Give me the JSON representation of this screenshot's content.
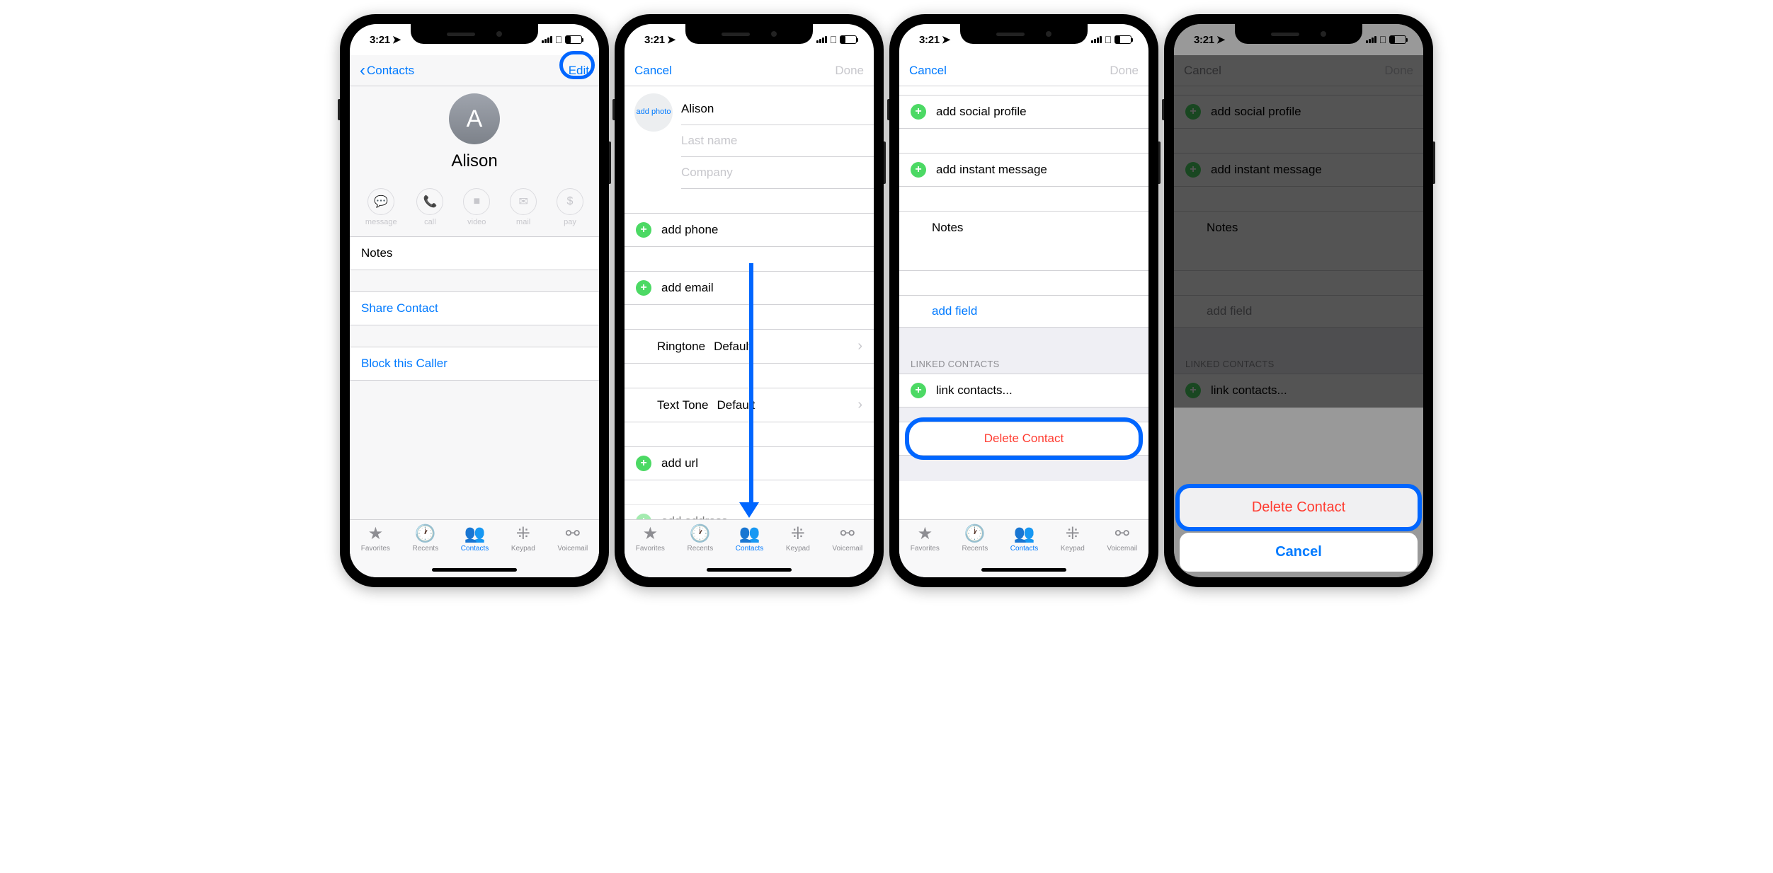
{
  "status": {
    "time": "3:21",
    "location_arrow": "↗"
  },
  "tabs": {
    "favorites": "Favorites",
    "recents": "Recents",
    "contacts": "Contacts",
    "keypad": "Keypad",
    "voicemail": "Voicemail"
  },
  "screen1": {
    "back": "Contacts",
    "edit": "Edit",
    "avatar_initial": "A",
    "name": "Alison",
    "actions": {
      "message": "message",
      "call": "call",
      "video": "video",
      "mail": "mail",
      "pay": "pay"
    },
    "notes": "Notes",
    "share": "Share Contact",
    "block": "Block this Caller"
  },
  "screen2": {
    "cancel": "Cancel",
    "done": "Done",
    "add_photo": "add photo",
    "first_name": "Alison",
    "last_name_ph": "Last name",
    "company_ph": "Company",
    "add_phone": "add phone",
    "add_email": "add email",
    "ringtone_label": "Ringtone",
    "ringtone_value": "Default",
    "texttone_label": "Text Tone",
    "texttone_value": "Default",
    "add_url": "add url",
    "add_address": "add address"
  },
  "screen3": {
    "cancel": "Cancel",
    "done": "Done",
    "add_social": "add social profile",
    "add_im": "add instant message",
    "notes": "Notes",
    "add_field": "add field",
    "linked_header": "LINKED CONTACTS",
    "link_contacts": "link contacts...",
    "delete": "Delete Contact"
  },
  "screen4": {
    "cancel": "Cancel",
    "done": "Done",
    "add_social": "add social profile",
    "add_im": "add instant message",
    "notes": "Notes",
    "add_field": "add field",
    "linked_header": "LINKED CONTACTS",
    "link_contacts": "link contacts...",
    "sheet_delete": "Delete Contact",
    "sheet_cancel": "Cancel"
  }
}
